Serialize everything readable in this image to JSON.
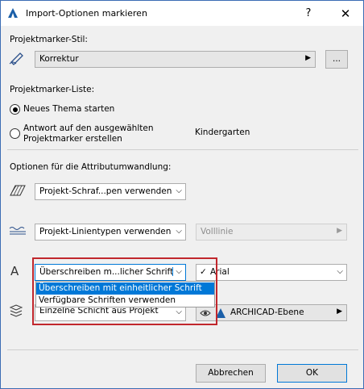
{
  "window": {
    "title": "Import-Optionen markieren",
    "help": "?",
    "close": "✕"
  },
  "section_stil": {
    "label": "Projektmarker-Stil:",
    "value": "Korrektur",
    "browse": "..."
  },
  "section_liste": {
    "label": "Projektmarker-Liste:",
    "opt1": "Neues Thema starten",
    "opt2_line1": "Antwort auf den ausgewählten",
    "opt2_line2": "Projektmarker erstellen",
    "opt2_target": "Kindergarten",
    "selected": "Neues Thema starten"
  },
  "section_attr": {
    "label": "Optionen für die Attributumwandlung:",
    "schraffur": "Projekt-Schraf...pen verwenden",
    "linien": "Projekt-Linientypen verwenden",
    "linien_value": "Volllinie",
    "schrift": "Überschreiben m...licher Schrift",
    "schrift_value": "Arial",
    "schrift_check": "✓",
    "ebenen": "Einzelne Schicht aus Projekt",
    "ebenen_value": "ARCHICAD-Ebene"
  },
  "menu": {
    "items": [
      "Überschreiben mit einheitlicher Schrift",
      "Verfügbare Schriften verwenden"
    ],
    "selected": 0
  },
  "buttons": {
    "cancel": "Abbrechen",
    "ok": "OK"
  },
  "colors": {
    "accent": "#0078d7",
    "highlight": "#c1272d",
    "title_border": "#3c6db4"
  }
}
